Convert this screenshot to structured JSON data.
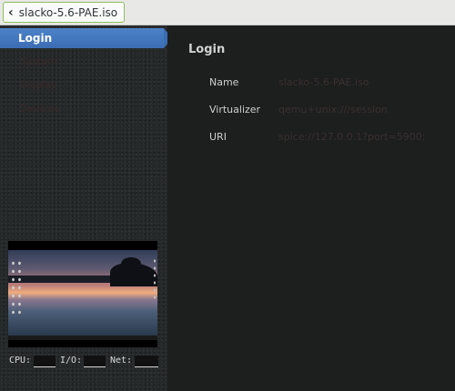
{
  "header": {
    "back_label": "slacko-5.6-PAE.iso"
  },
  "sidebar": {
    "items": [
      {
        "label": "Login"
      },
      {
        "label": "System"
      },
      {
        "label": "Display"
      },
      {
        "label": "Devices"
      }
    ],
    "stats": {
      "cpu_label": "CPU:",
      "io_label": "I/O:",
      "net_label": "Net:"
    }
  },
  "main": {
    "title": "Login",
    "rows": [
      {
        "label": "Name",
        "value": "slacko-5.6-PAE.iso"
      },
      {
        "label": "Virtualizer",
        "value": "qemu+unix:///session"
      },
      {
        "label": "URI",
        "value": "spice://127.0.0.1?port=5900;"
      }
    ]
  }
}
